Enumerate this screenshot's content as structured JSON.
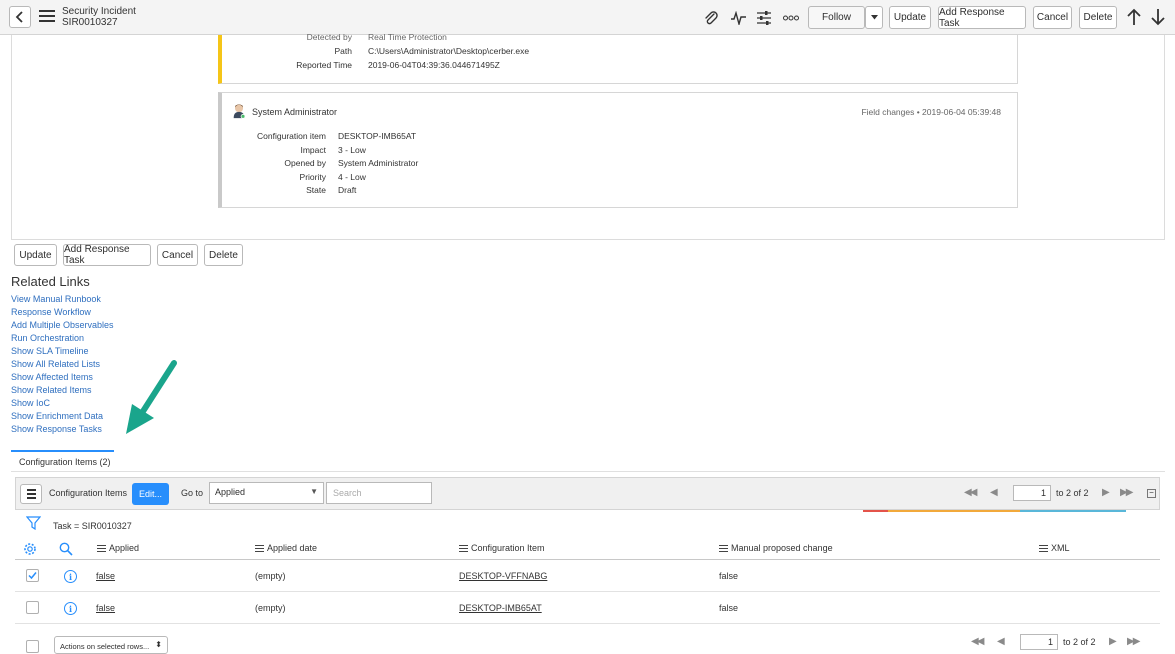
{
  "header": {
    "record_type": "Security Incident",
    "record_number": "SIR0010327",
    "buttons": {
      "follow": "Follow",
      "update": "Update",
      "add_response_task": "Add Response Task",
      "cancel": "Cancel",
      "delete": "Delete"
    }
  },
  "activity": {
    "card1": {
      "rows": [
        {
          "key": "Detected by",
          "value": "Real Time Protection"
        },
        {
          "key": "Path",
          "value": "C:\\Users\\Administrator\\Desktop\\cerber.exe"
        },
        {
          "key": "Reported Time",
          "value": "2019-06-04T04:39:36.044671495Z"
        }
      ]
    },
    "card2": {
      "author": "System Administrator",
      "meta": "Field changes  •  2019-06-04 05:39:48",
      "rows": [
        {
          "key": "Configuration item",
          "value": "DESKTOP-IMB65AT"
        },
        {
          "key": "Impact",
          "value": "3 - Low"
        },
        {
          "key": "Opened by",
          "value": "System Administrator"
        },
        {
          "key": "Priority",
          "value": "4 - Low"
        },
        {
          "key": "State",
          "value": "Draft"
        }
      ]
    }
  },
  "form_buttons": {
    "update": "Update",
    "add_response_task": "Add Response Task",
    "cancel": "Cancel",
    "delete": "Delete"
  },
  "related_links": {
    "title": "Related Links",
    "items": [
      "View Manual Runbook",
      "Response Workflow",
      "Add Multiple Observables",
      "Run Orchestration",
      "Show SLA Timeline",
      "Show All Related Lists",
      "Show Affected Items",
      "Show Related Items",
      "Show IoC",
      "Show Enrichment Data",
      "Show Response Tasks"
    ]
  },
  "related_list": {
    "tab_label": "Configuration Items (2)",
    "toolbar_title": "Configuration Items",
    "edit_label": "Edit...",
    "goto_label": "Go to",
    "goto_value": "Applied",
    "search_placeholder": "Search",
    "page_value": "1",
    "page_text": "to 2 of 2",
    "filter": "Task = SIR0010327",
    "columns": [
      "Applied",
      "Applied date",
      "Configuration Item",
      "Manual proposed change",
      "XML"
    ],
    "rows": [
      {
        "checked": true,
        "applied": "false",
        "applied_date": "(empty)",
        "ci": "DESKTOP-VFFNABG",
        "manual": "false",
        "xml": ""
      },
      {
        "checked": false,
        "applied": "false",
        "applied_date": "(empty)",
        "ci": "DESKTOP-IMB65AT",
        "manual": "false",
        "xml": ""
      }
    ],
    "actions_label": "Actions on selected rows...",
    "bottom_page_value": "1",
    "bottom_page_text": "to 2 of 2"
  },
  "colors": {
    "accent": "#278efc",
    "link": "#2f6fbf",
    "card1_border": "#f5c518",
    "arrow": "#1aa58c",
    "colorbar": [
      "#e4534a",
      "#f2a93b",
      "#f6c343",
      "#59b7d9"
    ]
  },
  "icons": [
    "back-icon",
    "menu-icon",
    "paperclip-icon",
    "activity-icon",
    "settings-sliders-icon",
    "more-icon",
    "dropdown-caret-icon",
    "arrow-up-icon",
    "arrow-down-icon",
    "filter-icon",
    "gear-icon",
    "search-icon",
    "info-icon",
    "checkbox-icon"
  ]
}
